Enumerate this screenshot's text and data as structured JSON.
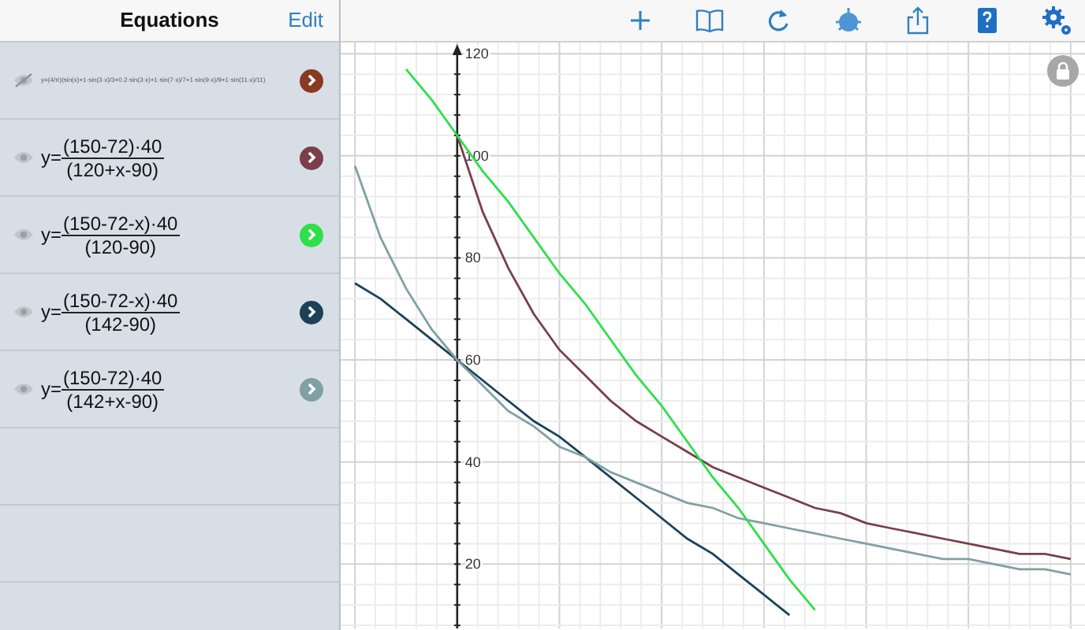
{
  "sidebar": {
    "title": "Equations",
    "edit_button": "Edit",
    "equations": [
      {
        "kind": "inline",
        "visible": false,
        "color": "#8a3a22",
        "formula": "y=(4/π)(sin(x)+1·sin(3·x)/3+0.2·sin(3·x)+1·sin(7·x)/7+1·sin(9·x)/9+1·sin(11·x)/11)"
      },
      {
        "kind": "fraction",
        "visible": true,
        "color": "#7a3f4a",
        "prefix": "y=",
        "numerator": "(150-72)·40",
        "denominator": "(120+x-90)"
      },
      {
        "kind": "fraction",
        "visible": true,
        "color": "#2ee04a",
        "prefix": "y=",
        "numerator": "(150-72-x)·40",
        "denominator": "(120-90)"
      },
      {
        "kind": "fraction",
        "visible": true,
        "color": "#1c4258",
        "prefix": "y=",
        "numerator": "(150-72-x)·40",
        "denominator": "(142-90)"
      },
      {
        "kind": "fraction",
        "visible": true,
        "color": "#7fa1a3",
        "prefix": "y=",
        "numerator": "(150-72)·40",
        "denominator": "(142+x-90)"
      }
    ]
  },
  "graph": {
    "locked": true,
    "chart_data": {
      "type": "line",
      "grid": true,
      "ylim": [
        7.4,
        122.2
      ],
      "yticks": [
        {
          "value": 20,
          "label": "20"
        },
        {
          "value": 40,
          "label": "40"
        },
        {
          "value": 60,
          "label": "60"
        },
        {
          "value": 80,
          "label": "80"
        },
        {
          "value": 100,
          "label": "100"
        },
        {
          "value": 120,
          "label": "120"
        }
      ],
      "categories": [
        null,
        null,
        null,
        null,
        null,
        null,
        null,
        null,
        null,
        null,
        null,
        null,
        null,
        null,
        null,
        null,
        null,
        null,
        null,
        null,
        null,
        null,
        null,
        null,
        null,
        null,
        null,
        null,
        null
      ],
      "series": [
        {
          "color": "#7a3f4a",
          "values": [
            null,
            null,
            null,
            null,
            104,
            89,
            78,
            69,
            62,
            57,
            52,
            48,
            45,
            42,
            39,
            37,
            35,
            33,
            31,
            30,
            28,
            27,
            26,
            25,
            24,
            23,
            22,
            22,
            21
          ]
        },
        {
          "color": "#2ee04a",
          "values": [
            null,
            null,
            117,
            111,
            104,
            97,
            91,
            84,
            77,
            71,
            64,
            57,
            51,
            44,
            37,
            31,
            24,
            17,
            11,
            null,
            null,
            null,
            null,
            null,
            null,
            null,
            null,
            null,
            null
          ]
        },
        {
          "color": "#1c4258",
          "values": [
            75,
            72,
            68,
            64,
            60,
            56,
            52,
            48,
            45,
            41,
            37,
            33,
            29,
            25,
            22,
            18,
            14,
            10,
            null,
            null,
            null,
            null,
            null,
            null,
            null,
            null,
            null,
            null,
            null
          ]
        },
        {
          "color": "#7fa1a3",
          "values": [
            98,
            84,
            74,
            66,
            60,
            55,
            50,
            47,
            43,
            41,
            38,
            36,
            34,
            32,
            31,
            29,
            28,
            27,
            26,
            25,
            24,
            23,
            22,
            21,
            21,
            20,
            19,
            19,
            18
          ]
        }
      ]
    }
  }
}
